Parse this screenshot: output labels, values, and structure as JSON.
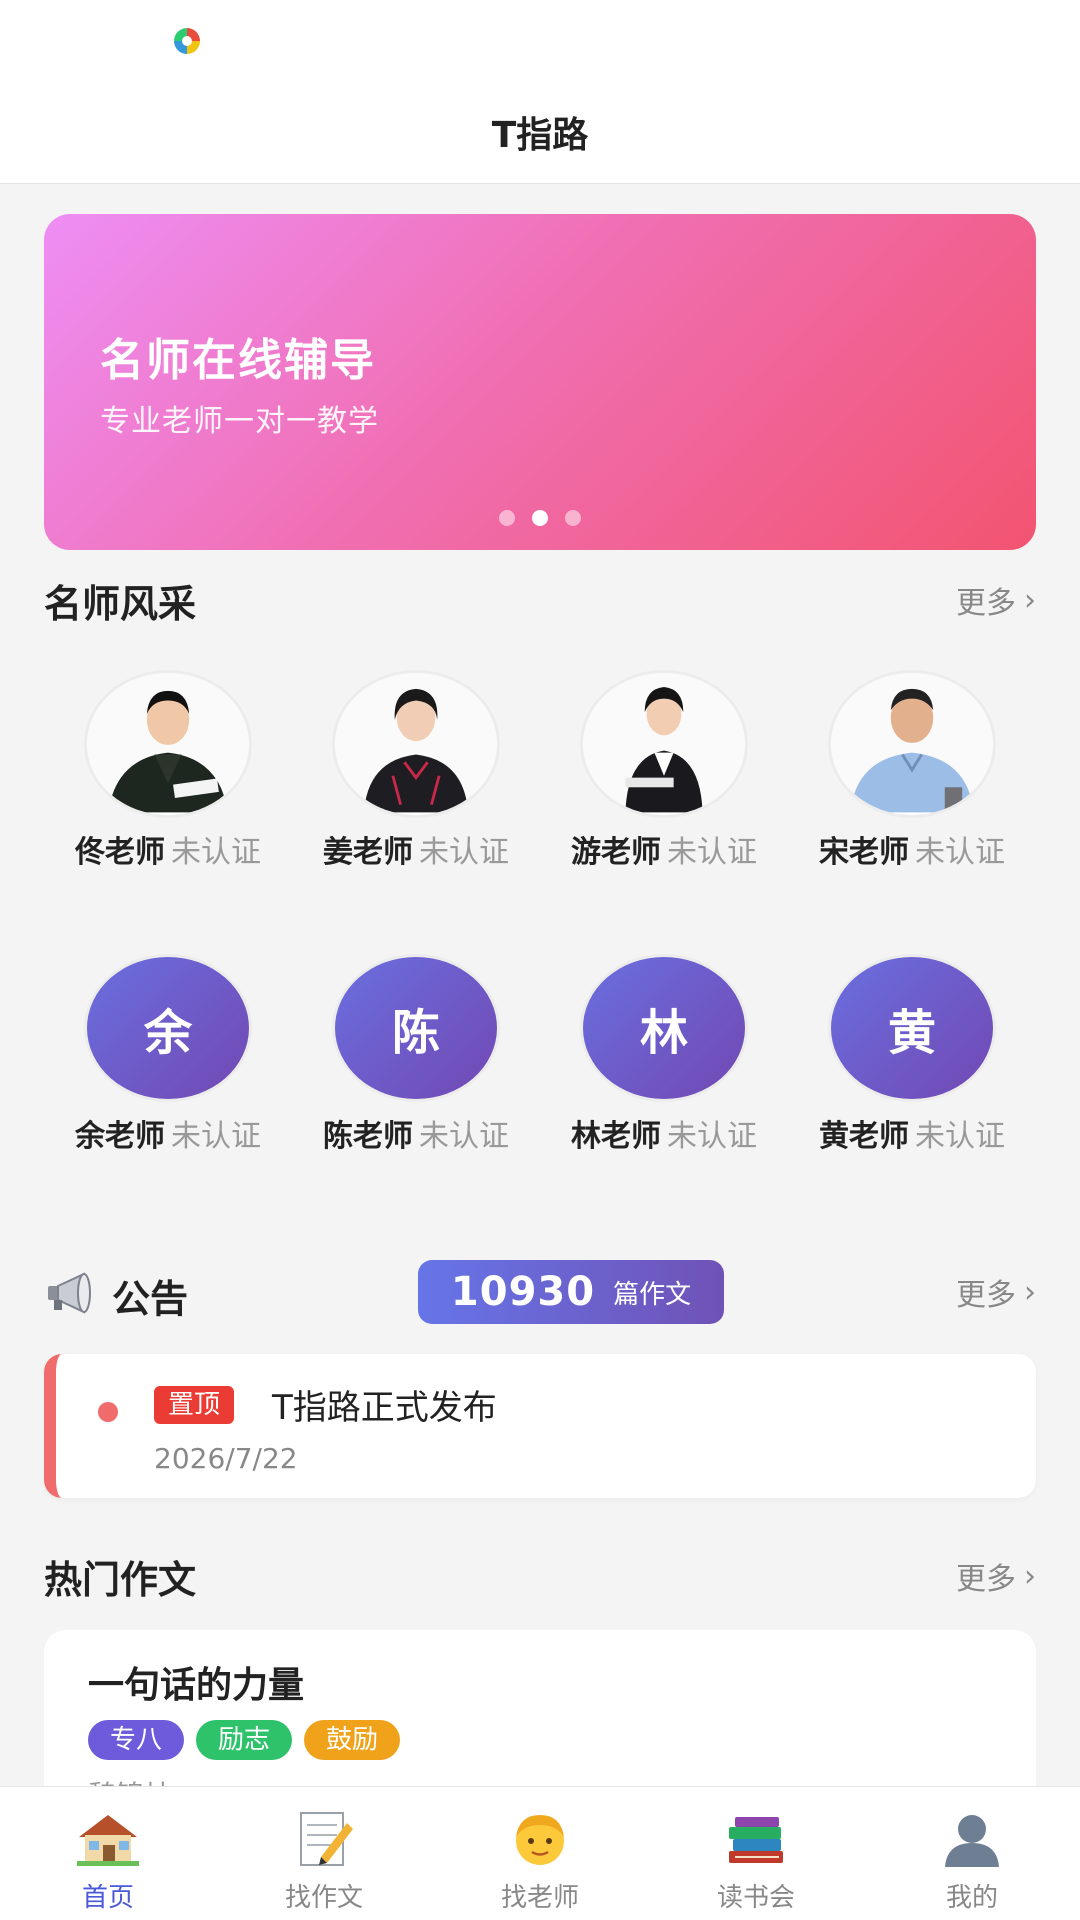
{
  "status_bar": {
    "app_icon": "app-notification-icon"
  },
  "header": {
    "title": "T指路"
  },
  "banner": {
    "title": "名师在线辅导",
    "subtitle": "专业老师一对一教学",
    "slide_count": 3,
    "active_slide": 2,
    "colors": {
      "start": "#ee8ef5",
      "end": "#f25470"
    }
  },
  "teachers_section": {
    "title": "名师风采",
    "more": "更多",
    "teachers": [
      {
        "name": "佟老师",
        "status": "未认证",
        "avatar": "photo-man-black-jacket"
      },
      {
        "name": "姜老师",
        "status": "未认证",
        "avatar": "photo-woman-black-suit"
      },
      {
        "name": "游老师",
        "status": "未认证",
        "avatar": "photo-woman-white-shirt"
      },
      {
        "name": "宋老师",
        "status": "未认证",
        "avatar": "photo-man-blue-shirt"
      },
      {
        "name": "余老师",
        "status": "未认证",
        "initial": "余"
      },
      {
        "name": "陈老师",
        "status": "未认证",
        "initial": "陈"
      },
      {
        "name": "林老师",
        "status": "未认证",
        "initial": "林"
      },
      {
        "name": "黄老师",
        "status": "未认证",
        "initial": "黄"
      }
    ]
  },
  "notice_section": {
    "title": "公告",
    "count": "10930",
    "count_unit": "篇作文",
    "more": "更多",
    "items": [
      {
        "pin": "置顶",
        "text": "T指路正式发布",
        "date": "2026/7/22"
      }
    ]
  },
  "hot_section": {
    "title": "热门作文",
    "more": "更多",
    "essays": [
      {
        "title": "一句话的力量",
        "tags": [
          {
            "label": "专八",
            "color": "#6e5bdc"
          },
          {
            "label": "励志",
            "color": "#2ec26b"
          },
          {
            "label": "鼓励",
            "color": "#f0a31a"
          }
        ],
        "author": "魏锦灿"
      }
    ]
  },
  "bottom_nav": {
    "active": "首页",
    "items": [
      {
        "label": "首页",
        "icon": "house-icon"
      },
      {
        "label": "找作文",
        "icon": "notepad-pencil-icon"
      },
      {
        "label": "找老师",
        "icon": "person-face-icon"
      },
      {
        "label": "读书会",
        "icon": "books-icon"
      },
      {
        "label": "我的",
        "icon": "user-silhouette-icon"
      }
    ]
  },
  "accent_color": "#4a59d8"
}
